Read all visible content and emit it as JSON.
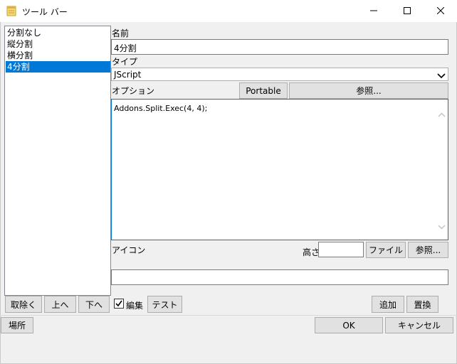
{
  "window": {
    "title": "ツール バー"
  },
  "list": {
    "items": [
      {
        "label": "分割なし",
        "selected": false
      },
      {
        "label": "縦分割",
        "selected": false
      },
      {
        "label": "横分割",
        "selected": false
      },
      {
        "label": "4分割",
        "selected": true
      }
    ]
  },
  "form": {
    "name_label": "名前",
    "name_value": "4分割",
    "type_label": "タイプ",
    "type_value": "JScript",
    "option_label": "オプション",
    "portable_button": "Portable",
    "browse_button": "参照...",
    "code": "Addons.Split.Exec(4, 4);",
    "icon_label": "アイコン",
    "height_label": "高さ",
    "height_value": "",
    "file_button": "ファイル",
    "icon_browse_button": "参照...",
    "icon_value": ""
  },
  "actions": {
    "remove": "取除く",
    "up": "上へ",
    "down": "下へ",
    "edit_checkbox": "編集",
    "edit_checked": true,
    "test": "テスト",
    "add": "追加",
    "replace": "置換",
    "location": "場所",
    "ok": "OK",
    "cancel": "キャンセル"
  },
  "colors": {
    "selection": "#0078d7",
    "focus_border": "#0078d7",
    "button_face": "#e1e1e1",
    "button_border": "#adadad",
    "dialog_bg": "#f0f0f0"
  }
}
